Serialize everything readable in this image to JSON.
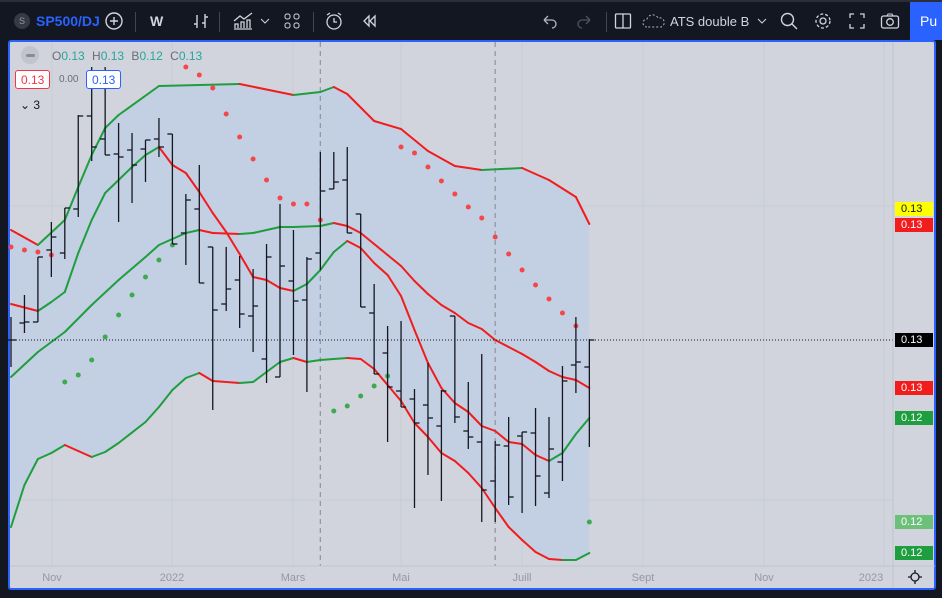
{
  "toolbar": {
    "symbol_initial": "S",
    "symbol": "SP500/DJ",
    "interval": "W",
    "indicator_template": "ATS double B",
    "publish": "Pu"
  },
  "legend": {
    "o_label": "O",
    "o": "0.13",
    "h_label": "H",
    "h": "0.13",
    "l_label": "B",
    "l": "0.12",
    "c_label": "C",
    "c": "0.13",
    "sell": "0.13",
    "spread": "0.00",
    "buy": "0.13",
    "indicators_count": "3"
  },
  "colors": {
    "up": "#089981",
    "band_up": "#1e9e3e",
    "band_down": "#f21c1c",
    "sar_up": "#f44848",
    "sar_down": "#3daa4f",
    "fill": "#c3cfe2",
    "bars": "#131722",
    "accent": "#2962ff"
  },
  "chart_data": {
    "type": "ohlc",
    "price_unit": 1e-05,
    "x_labels": [
      "Nov",
      "2022",
      "Mars",
      "Mai",
      "Juill",
      "Sept",
      "Nov",
      "2023"
    ],
    "bars": [
      [
        12650,
        12696,
        12596,
        12650
      ],
      [
        12684,
        12740,
        12664,
        12686
      ],
      [
        12686,
        12816,
        12686,
        12816
      ],
      [
        12830,
        12886,
        12776,
        12856
      ],
      [
        12824,
        12914,
        12812,
        12914
      ],
      [
        12912,
        13100,
        12896,
        13098
      ],
      [
        13098,
        13196,
        13008,
        13036
      ],
      [
        13052,
        13196,
        13020,
        13020
      ],
      [
        13022,
        13084,
        12886,
        13016
      ],
      [
        13030,
        13064,
        12924,
        13000
      ],
      [
        13032,
        13050,
        12966,
        13050
      ],
      [
        13052,
        13094,
        13016,
        13036
      ],
      [
        13062,
        13062,
        12842,
        12842
      ],
      [
        12864,
        12942,
        12800,
        12930
      ],
      [
        12912,
        13000,
        12764,
        12764
      ],
      [
        12836,
        12836,
        12510,
        12710
      ],
      [
        12722,
        12836,
        12708,
        12752
      ],
      [
        12770,
        12818,
        12674,
        12702
      ],
      [
        12698,
        12792,
        12626,
        12718
      ],
      [
        12612,
        12842,
        12564,
        12816
      ],
      [
        12576,
        12922,
        12576,
        12798
      ],
      [
        12768,
        12870,
        12620,
        12728
      ],
      [
        12730,
        12816,
        12546,
        12812
      ],
      [
        12824,
        13026,
        12790,
        12948
      ],
      [
        12952,
        13026,
        12952,
        12966
      ],
      [
        12970,
        13036,
        12864,
        12864
      ],
      [
        12902,
        12902,
        12716,
        12716
      ],
      [
        12704,
        12762,
        12582,
        12582
      ],
      [
        12624,
        12678,
        12446,
        12556
      ],
      [
        12548,
        12688,
        12516,
        12516
      ],
      [
        12532,
        12552,
        12314,
        12484
      ],
      [
        12520,
        12604,
        12380,
        12494
      ],
      [
        12478,
        12550,
        12328,
        12548
      ],
      [
        12698,
        12698,
        12484,
        12496
      ],
      [
        12468,
        12566,
        12432,
        12456
      ],
      [
        12446,
        12622,
        12286,
        12350
      ],
      [
        12368,
        12448,
        12286,
        12440
      ],
      [
        12438,
        12496,
        12320,
        12336
      ],
      [
        12458,
        12466,
        12304,
        12466
      ],
      [
        12464,
        12514,
        12318,
        12378
      ],
      [
        12344,
        12496,
        12334,
        12432
      ],
      [
        12406,
        12598,
        12368,
        12568
      ],
      [
        12600,
        12696,
        12544,
        12606
      ],
      [
        12596,
        12652,
        12436,
        12650
      ]
    ],
    "bands": [
      {
        "name": "upper-outer",
        "points": [
          [
            0,
            12870
          ],
          [
            2,
            12840
          ],
          [
            4,
            12890
          ],
          [
            5,
            12956
          ],
          [
            6,
            13020
          ],
          [
            7,
            13074
          ],
          [
            8,
            13100
          ],
          [
            11,
            13158
          ],
          [
            17,
            13162
          ],
          [
            21,
            13140
          ],
          [
            23,
            13146
          ],
          [
            24,
            13156
          ],
          [
            25,
            13142
          ],
          [
            27,
            13088
          ],
          [
            29,
            13072
          ],
          [
            31,
            13028
          ],
          [
            33,
            12998
          ],
          [
            35,
            12990
          ],
          [
            38,
            12994
          ],
          [
            40,
            12970
          ],
          [
            42,
            12936
          ],
          [
            43,
            12882
          ]
        ]
      },
      {
        "name": "upper-inner",
        "points": [
          [
            0,
            12722
          ],
          [
            2,
            12708
          ],
          [
            3,
            12726
          ],
          [
            4,
            12746
          ],
          [
            5,
            12824
          ],
          [
            6,
            12890
          ],
          [
            7,
            12944
          ],
          [
            8,
            12970
          ],
          [
            9,
            12996
          ],
          [
            10,
            13020
          ],
          [
            11,
            13036
          ],
          [
            12,
            13000
          ],
          [
            13,
            12984
          ],
          [
            14,
            12946
          ],
          [
            15,
            12904
          ],
          [
            16,
            12866
          ],
          [
            17,
            12822
          ],
          [
            18,
            12776
          ],
          [
            19,
            12770
          ],
          [
            20,
            12754
          ],
          [
            21,
            12748
          ],
          [
            22,
            12762
          ],
          [
            23,
            12790
          ],
          [
            24,
            12826
          ],
          [
            25,
            12848
          ],
          [
            26,
            12834
          ],
          [
            27,
            12804
          ],
          [
            28,
            12780
          ],
          [
            29,
            12738
          ],
          [
            30,
            12670
          ],
          [
            31,
            12604
          ],
          [
            32,
            12554
          ],
          [
            33,
            12524
          ],
          [
            34,
            12506
          ],
          [
            35,
            12478
          ],
          [
            36,
            12468
          ],
          [
            37,
            12446
          ],
          [
            38,
            12442
          ],
          [
            39,
            12420
          ],
          [
            40,
            12408
          ],
          [
            41,
            12424
          ],
          [
            42,
            12462
          ],
          [
            43,
            12494
          ]
        ]
      },
      {
        "name": "middle",
        "points": [
          [
            0,
            12576
          ],
          [
            2,
            12626
          ],
          [
            4,
            12666
          ],
          [
            6,
            12720
          ],
          [
            8,
            12770
          ],
          [
            10,
            12816
          ],
          [
            11,
            12840
          ],
          [
            13,
            12864
          ],
          [
            14,
            12870
          ],
          [
            15,
            12864
          ],
          [
            17,
            12862
          ],
          [
            18,
            12864
          ],
          [
            20,
            12876
          ],
          [
            21,
            12876
          ],
          [
            23,
            12878
          ],
          [
            24,
            12884
          ],
          [
            25,
            12878
          ],
          [
            26,
            12864
          ],
          [
            27,
            12842
          ],
          [
            28,
            12820
          ],
          [
            29,
            12798
          ],
          [
            30,
            12768
          ],
          [
            31,
            12742
          ],
          [
            32,
            12720
          ],
          [
            33,
            12704
          ],
          [
            34,
            12684
          ],
          [
            35,
            12672
          ],
          [
            36,
            12650
          ],
          [
            37,
            12636
          ],
          [
            38,
            12622
          ],
          [
            39,
            12606
          ],
          [
            40,
            12588
          ],
          [
            41,
            12576
          ],
          [
            42,
            12570
          ],
          [
            43,
            12554
          ]
        ]
      },
      {
        "name": "lower-outer",
        "points": [
          [
            0,
            12276
          ],
          [
            1,
            12360
          ],
          [
            2,
            12412
          ],
          [
            3,
            12424
          ],
          [
            4,
            12440
          ],
          [
            5,
            12428
          ],
          [
            6,
            12416
          ],
          [
            7,
            12426
          ],
          [
            8,
            12444
          ],
          [
            10,
            12486
          ],
          [
            11,
            12516
          ],
          [
            12,
            12550
          ],
          [
            13,
            12574
          ],
          [
            14,
            12584
          ],
          [
            15,
            12568
          ],
          [
            17,
            12564
          ],
          [
            18,
            12566
          ],
          [
            19,
            12586
          ],
          [
            20,
            12606
          ],
          [
            21,
            12614
          ],
          [
            22,
            12606
          ],
          [
            23,
            12610
          ],
          [
            25,
            12614
          ],
          [
            26,
            12612
          ],
          [
            27,
            12592
          ],
          [
            28,
            12560
          ],
          [
            29,
            12528
          ],
          [
            30,
            12484
          ],
          [
            31,
            12456
          ],
          [
            32,
            12424
          ],
          [
            33,
            12408
          ],
          [
            34,
            12384
          ],
          [
            35,
            12354
          ],
          [
            36,
            12314
          ],
          [
            37,
            12276
          ],
          [
            38,
            12250
          ],
          [
            39,
            12226
          ],
          [
            40,
            12212
          ],
          [
            41,
            12210
          ],
          [
            42,
            12210
          ],
          [
            43,
            12224
          ]
        ]
      }
    ],
    "sar": [
      [
        0,
        12836,
        "above"
      ],
      [
        1,
        12830,
        "above"
      ],
      [
        2,
        12826,
        "above"
      ],
      [
        3,
        12820,
        "above"
      ],
      [
        4,
        12566,
        "below"
      ],
      [
        5,
        12580,
        "below"
      ],
      [
        6,
        12610,
        "below"
      ],
      [
        7,
        12656,
        "below"
      ],
      [
        8,
        12700,
        "below"
      ],
      [
        9,
        12740,
        "below"
      ],
      [
        10,
        12776,
        "below"
      ],
      [
        11,
        12810,
        "below"
      ],
      [
        12,
        12840,
        "below"
      ],
      [
        13,
        13196,
        "above"
      ],
      [
        14,
        13180,
        "above"
      ],
      [
        15,
        13154,
        "above"
      ],
      [
        16,
        13102,
        "above"
      ],
      [
        17,
        13056,
        "above"
      ],
      [
        18,
        13012,
        "above"
      ],
      [
        19,
        12970,
        "above"
      ],
      [
        20,
        12934,
        "above"
      ],
      [
        21,
        12922,
        "above"
      ],
      [
        22,
        12922,
        "above"
      ],
      [
        23,
        12890,
        "above"
      ],
      [
        24,
        12508,
        "below"
      ],
      [
        25,
        12518,
        "below"
      ],
      [
        26,
        12538,
        "below"
      ],
      [
        27,
        12558,
        "below"
      ],
      [
        28,
        12578,
        "below"
      ],
      [
        29,
        13036,
        "above"
      ],
      [
        30,
        13024,
        "above"
      ],
      [
        31,
        12996,
        "above"
      ],
      [
        32,
        12968,
        "above"
      ],
      [
        33,
        12942,
        "above"
      ],
      [
        34,
        12916,
        "above"
      ],
      [
        35,
        12894,
        "above"
      ],
      [
        36,
        12856,
        "above"
      ],
      [
        37,
        12822,
        "above"
      ],
      [
        38,
        12790,
        "above"
      ],
      [
        39,
        12760,
        "above"
      ],
      [
        40,
        12732,
        "above"
      ],
      [
        41,
        12704,
        "above"
      ],
      [
        42,
        12678,
        "above"
      ],
      [
        43,
        12286,
        "below"
      ]
    ],
    "session_breaks": [
      23,
      36
    ],
    "current_price": 12650,
    "price_labels": [
      {
        "text": "0.13",
        "value": 12912,
        "bg": "#ffff00",
        "fg": "#131722"
      },
      {
        "text": "0.13",
        "value": 12880,
        "bg": "#f21c1c",
        "fg": "#ffffff"
      },
      {
        "text": "0.13",
        "value": 12650,
        "bg": "#000000",
        "fg": "#ffffff"
      },
      {
        "text": "0.13",
        "value": 12554,
        "bg": "#f21c1c",
        "fg": "#ffffff"
      },
      {
        "text": "0.12",
        "value": 12494,
        "bg": "#1e9e3e",
        "fg": "#ffffff"
      },
      {
        "text": "0.12",
        "value": 12286,
        "bg": "#6cc07a",
        "fg": "#ffffff"
      },
      {
        "text": "0.12",
        "value": 12224,
        "bg": "#1e9e3e",
        "fg": "#ffffff"
      }
    ]
  }
}
